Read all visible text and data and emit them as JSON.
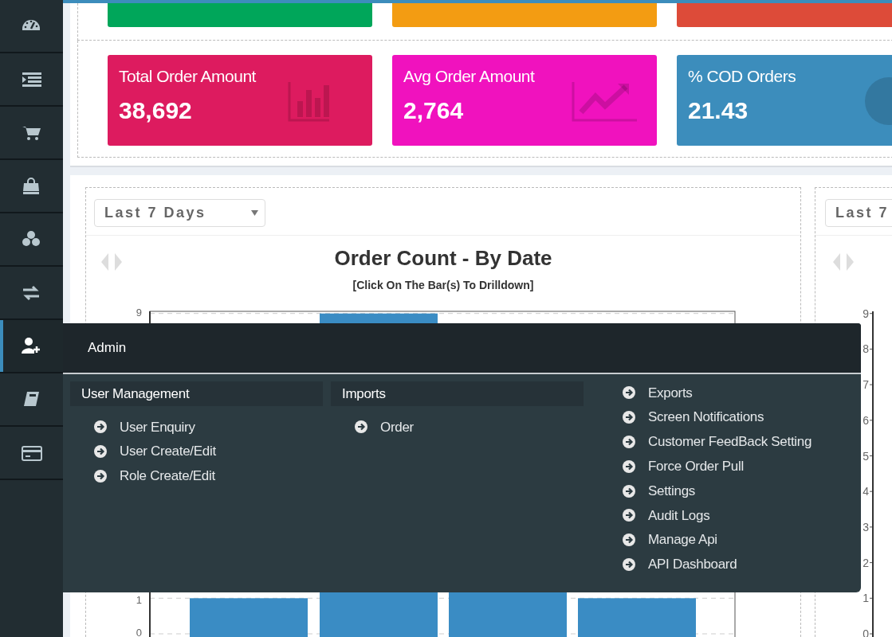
{
  "sidebar": {
    "items": [
      {
        "selected": false
      },
      {
        "selected": false
      },
      {
        "selected": false
      },
      {
        "selected": false
      },
      {
        "selected": false
      },
      {
        "selected": false
      },
      {
        "selected": true
      },
      {
        "selected": false
      },
      {
        "selected": false
      }
    ]
  },
  "top_cards": [
    {
      "color": "#00a65a"
    },
    {
      "color": "#f39c12"
    },
    {
      "color": "#dd4b39"
    }
  ],
  "stat_cards": [
    {
      "label": "Total Order Amount",
      "value": "38,692",
      "color": "#dd1b5f"
    },
    {
      "label": "Avg Order Amount",
      "value": "2,764",
      "color": "#f012be"
    },
    {
      "label": "% COD Orders",
      "value": "21.43",
      "color": "#3c8dbc"
    }
  ],
  "charts": [
    {
      "filter": "Last 7 Days",
      "title": "Order Count - By Date",
      "subtitle": "[Click On The Bar(s) To Drilldown]",
      "yticks": [
        "9",
        "1",
        "0"
      ]
    },
    {
      "filter": "Last 7",
      "yticks": [
        "9",
        "8",
        "7",
        "6",
        "5",
        "4",
        "3",
        "2",
        "1",
        "0"
      ]
    }
  ],
  "admin_menu": {
    "title": "Admin",
    "columns": [
      {
        "heading": "User Management",
        "items": [
          "User Enquiry",
          "User Create/Edit",
          "Role Create/Edit"
        ]
      },
      {
        "heading": "Imports",
        "items": [
          "Order"
        ]
      },
      {
        "items": [
          "Exports",
          "Screen Notifications",
          "Customer FeedBack Setting",
          "Force Order Pull",
          "Settings",
          "Audit Logs",
          "Manage Api",
          "API Dashboard"
        ]
      }
    ]
  }
}
